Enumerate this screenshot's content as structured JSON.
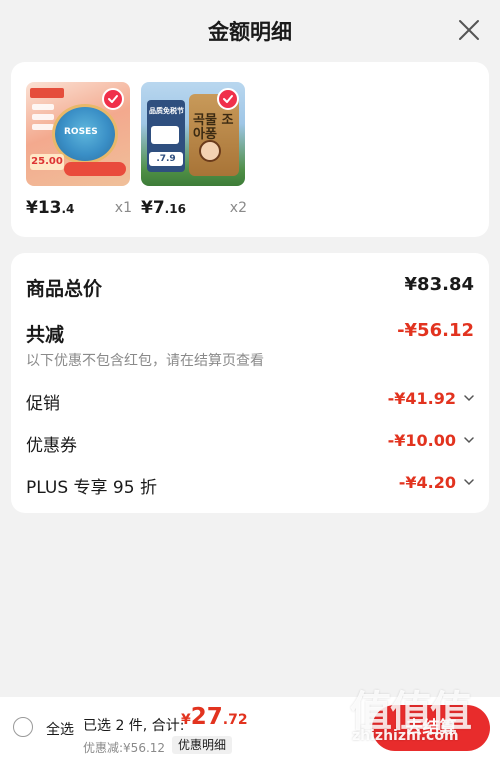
{
  "header": {
    "title": "金额明细"
  },
  "products": [
    {
      "price_int": "¥13",
      "price_dec": ".4",
      "qty": "x1",
      "thumb_label": "ROSES",
      "thumb_price": "25.00"
    },
    {
      "price_int": "¥7",
      "price_dec": ".16",
      "qty": "x2",
      "thumb_label": "곡물 조아퐁",
      "thumb_price": ".7.9"
    }
  ],
  "summary": {
    "total_label": "商品总价",
    "total_value": "¥83.84",
    "reduce_label": "共减",
    "reduce_value": "-¥56.12",
    "note": "以下优惠不包含红包，请在结算页查看",
    "items": [
      {
        "label": "促销",
        "value": "-¥41.92"
      },
      {
        "label": "优惠券",
        "value": "-¥10.00"
      },
      {
        "label": "PLUS 专享 95 折",
        "value": "-¥4.20"
      }
    ]
  },
  "bottom": {
    "select_all": "全选",
    "selected_text": "已选 2 件, 合计:",
    "total_yen": "¥",
    "total_int": "27",
    "total_dec": ".72",
    "discount": "优惠减:¥56.12",
    "detail_button": "优惠明细",
    "checkout_button": "去结算"
  },
  "watermark": {
    "chars": "值值值",
    "url": "zhizhizhi.com"
  },
  "colors": {
    "accent_red": "#e2331f",
    "checkout_red": "#e82c2c",
    "check_badge": "#f0304a"
  }
}
